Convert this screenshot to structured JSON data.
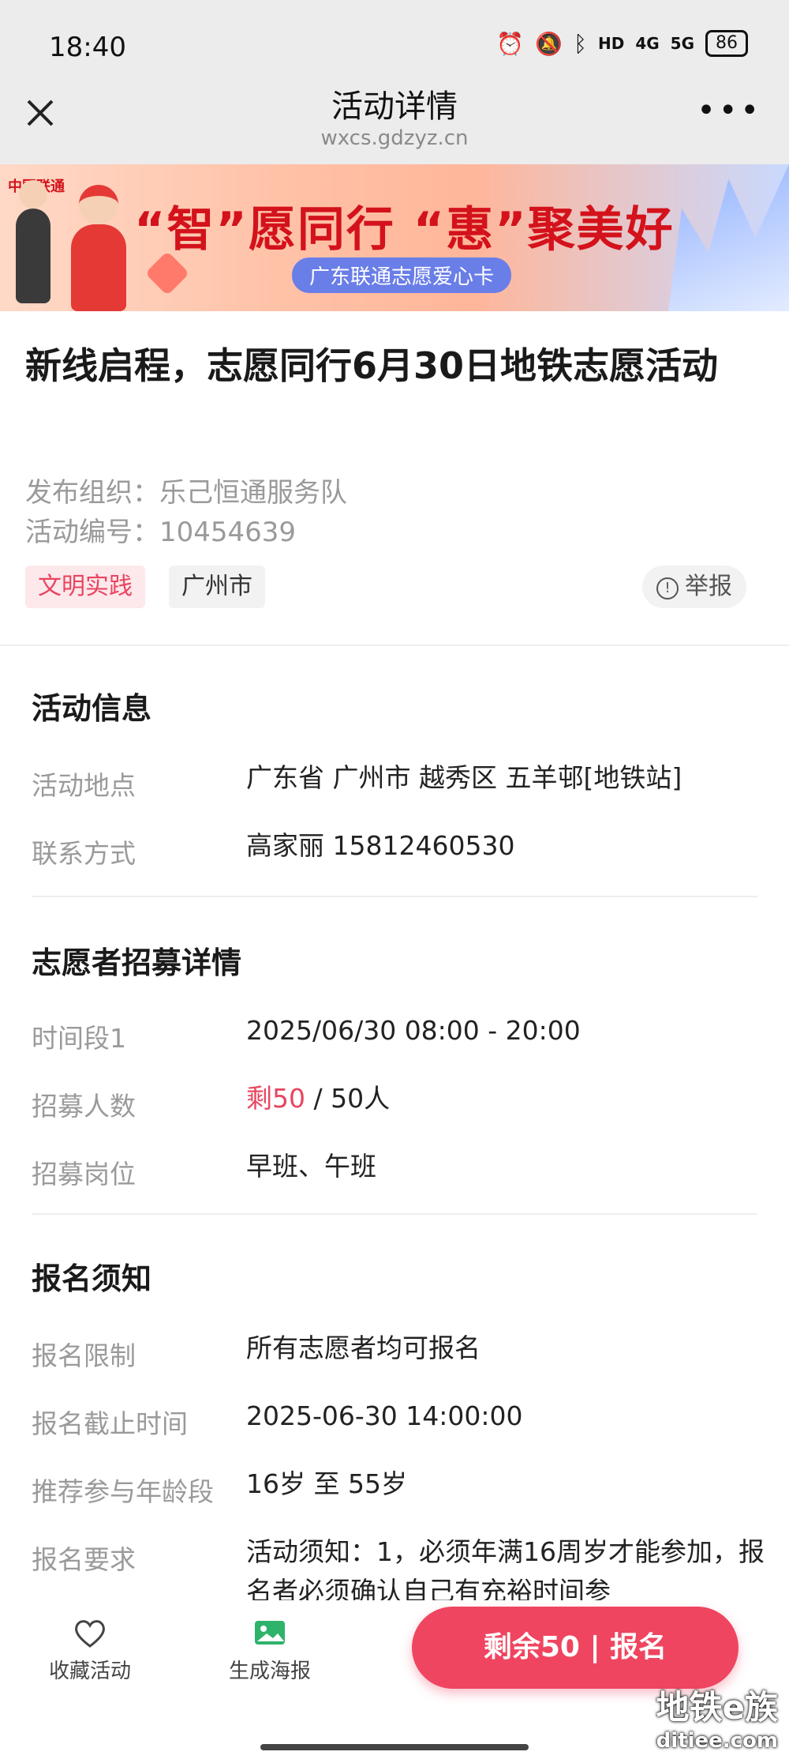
{
  "status_bar": {
    "time": "18:40",
    "network": "4G",
    "network2": "5G",
    "battery": "86"
  },
  "nav": {
    "title": "活动详情",
    "url": "wxcs.gdzyz.cn"
  },
  "banner": {
    "logo_text": "中国联通",
    "slogan": "“智”愿同行 “惠”聚美好",
    "subtitle": "广东联通志愿爱心卡"
  },
  "activity": {
    "title": "新线启程，志愿同行6月30日地铁志愿活动",
    "org_label": "发布组织：",
    "org_value": "乐己恒通服务队",
    "id_label": "活动编号：",
    "id_value": "10454639",
    "tags": [
      "文明实践",
      "广州市"
    ],
    "report_label": "举报"
  },
  "info": {
    "section_title": "活动信息",
    "location_label": "活动地点",
    "location_value": "广东省 广州市 越秀区 五羊邨[地铁站]",
    "contact_label": "联系方式",
    "contact_value": "高家丽 15812460530"
  },
  "recruit": {
    "section_title": "志愿者招募详情",
    "period_label": "时间段1",
    "period_value": "2025/06/30 08:00 - 20:00",
    "count_label": "招募人数",
    "count_remaining": "剩50",
    "count_total": " / 50人",
    "post_label": "招募岗位",
    "post_value": "早班、午班"
  },
  "notice": {
    "section_title": "报名须知",
    "limit_label": "报名限制",
    "limit_value": "所有志愿者均可报名",
    "deadline_label": "报名截止时间",
    "deadline_value": "2025-06-30 14:00:00",
    "age_label": "推荐参与年龄段",
    "age_value": "16岁 至 55岁",
    "req_label": "报名要求",
    "req_value": "活动须知：1，必须年满16周岁才能参加，报名者必须确认自己有充裕时间参"
  },
  "bottom_bar": {
    "favorite_label": "收藏活动",
    "poster_label": "生成海报",
    "signup_label": "剩余50 | 报名"
  },
  "watermark": {
    "line1": "地铁e族",
    "line2": "ditiee.com"
  },
  "colors": {
    "accent": "#ef4560",
    "tag_red": "#e8455f",
    "gray_text": "#9a9a9a"
  }
}
